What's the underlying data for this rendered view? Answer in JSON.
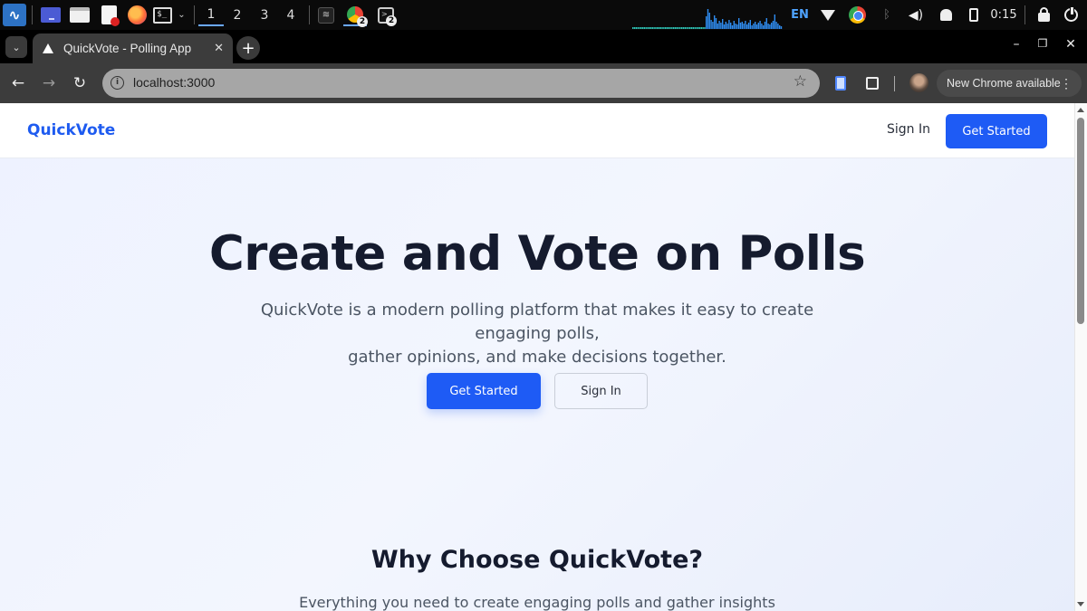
{
  "taskbar": {
    "workspaces": [
      "1",
      "2",
      "3",
      "4"
    ],
    "window_badges": [
      "2",
      "2"
    ],
    "language": "EN",
    "clock": "0:15",
    "net_graph_color": "#2f8cf0"
  },
  "browser": {
    "tab_title": "QuickVote - Polling App",
    "url": "localhost:3000",
    "update_label": "New Chrome available"
  },
  "page": {
    "nav": {
      "brand": "QuickVote",
      "sign_in": "Sign In",
      "get_started": "Get Started"
    },
    "hero": {
      "title": "Create and Vote on Polls",
      "subtitle_line1": "QuickVote is a modern polling platform that makes it easy to create engaging polls,",
      "subtitle_line2": "gather opinions, and make decisions together.",
      "primary_button": "Get Started",
      "secondary_button": "Sign In"
    },
    "features": {
      "title": "Why Choose QuickVote?",
      "subtitle": "Everything you need to create engaging polls and gather insights"
    }
  },
  "colors": {
    "brand_blue": "#1e5bf5",
    "heading": "#151b2e",
    "body_text": "#4b5563"
  }
}
